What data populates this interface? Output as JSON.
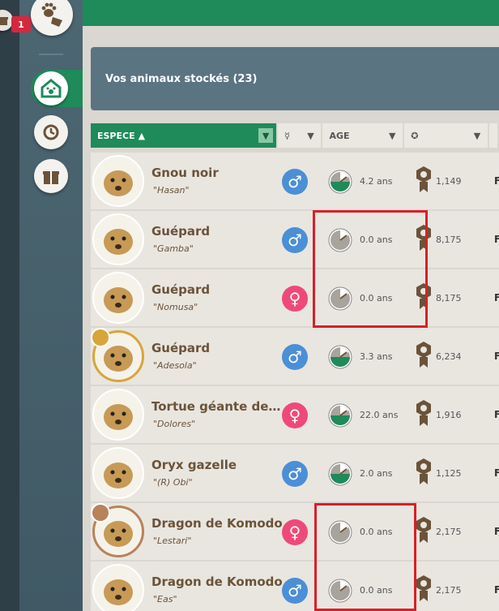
{
  "sidebar": {
    "badge_count": "1",
    "icons": [
      "paw-tag-icon",
      "home-paw-icon",
      "history-icon",
      "gift-icon"
    ]
  },
  "title": "Vos animaux stockés (23)",
  "columns": {
    "espece": "ESPECE",
    "age": "AGE"
  },
  "animals": [
    {
      "name": "Gnou noir",
      "nick": "\"Hasan\"",
      "sex": "m",
      "age": "4.2 ans",
      "rep": "1,149",
      "frame": "none",
      "fcol": "F"
    },
    {
      "name": "Guépard",
      "nick": "\"Gamba\"",
      "sex": "m",
      "age": "0.0 ans",
      "rep": "8,175",
      "frame": "none",
      "fcol": "F"
    },
    {
      "name": "Guépard",
      "nick": "\"Nomusa\"",
      "sex": "f",
      "age": "0.0 ans",
      "rep": "8,175",
      "frame": "none",
      "fcol": "F"
    },
    {
      "name": "Guépard",
      "nick": "\"Adesola\"",
      "sex": "m",
      "age": "3.3 ans",
      "rep": "6,234",
      "frame": "gold",
      "fcol": "F"
    },
    {
      "name": "Tortue géante des...",
      "nick": "\"Dolores\"",
      "sex": "f",
      "age": "22.0 ans",
      "rep": "1,916",
      "frame": "none",
      "fcol": "F"
    },
    {
      "name": "Oryx gazelle",
      "nick": "\"(R) Obi\"",
      "sex": "m",
      "age": "2.0 ans",
      "rep": "1,125",
      "frame": "none",
      "fcol": "F"
    },
    {
      "name": "Dragon de Komodo",
      "nick": "\"Lestari\"",
      "sex": "f",
      "age": "0.0 ans",
      "rep": "2,175",
      "frame": "bronze",
      "fcol": "F"
    },
    {
      "name": "Dragon de Komodo",
      "nick": "\"Eas\"",
      "sex": "m",
      "age": "0.0 ans",
      "rep": "2,175",
      "frame": "none",
      "fcol": "F"
    }
  ],
  "colors": {
    "green": "#1f8a5a",
    "male": "#4b8fd6",
    "female": "#ef4a77",
    "highlight": "#d91f2a"
  }
}
